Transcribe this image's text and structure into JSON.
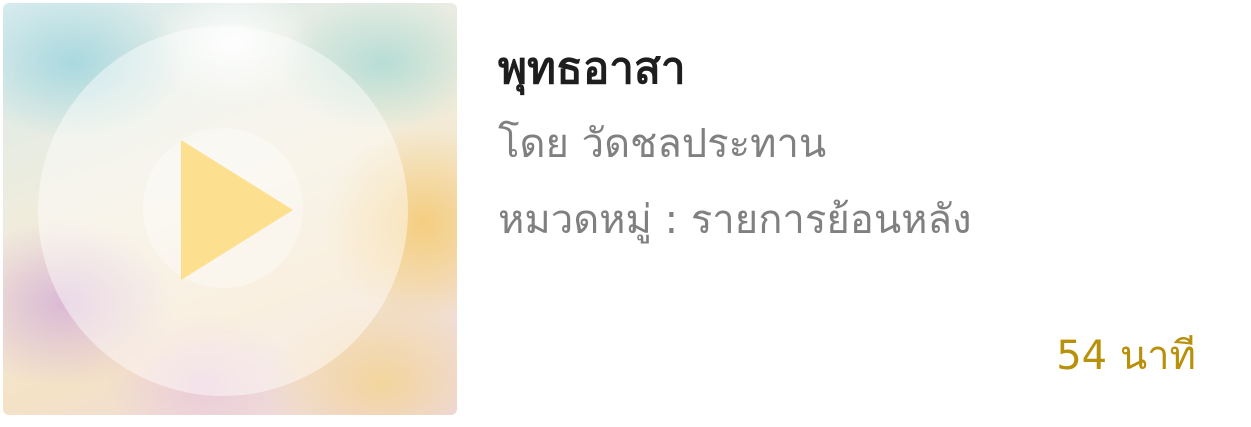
{
  "item": {
    "title": "พุทธอาสา",
    "author": "โดย วัดชลประทาน",
    "category": "หมวดหมู่ : รายการย้อนหลัง",
    "duration": "54 นาที",
    "thumbnail_icon": "play-icon"
  },
  "colors": {
    "title": "#1e1e1e",
    "meta": "#808080",
    "duration": "#b8900a",
    "play_icon": "#fde08f"
  }
}
